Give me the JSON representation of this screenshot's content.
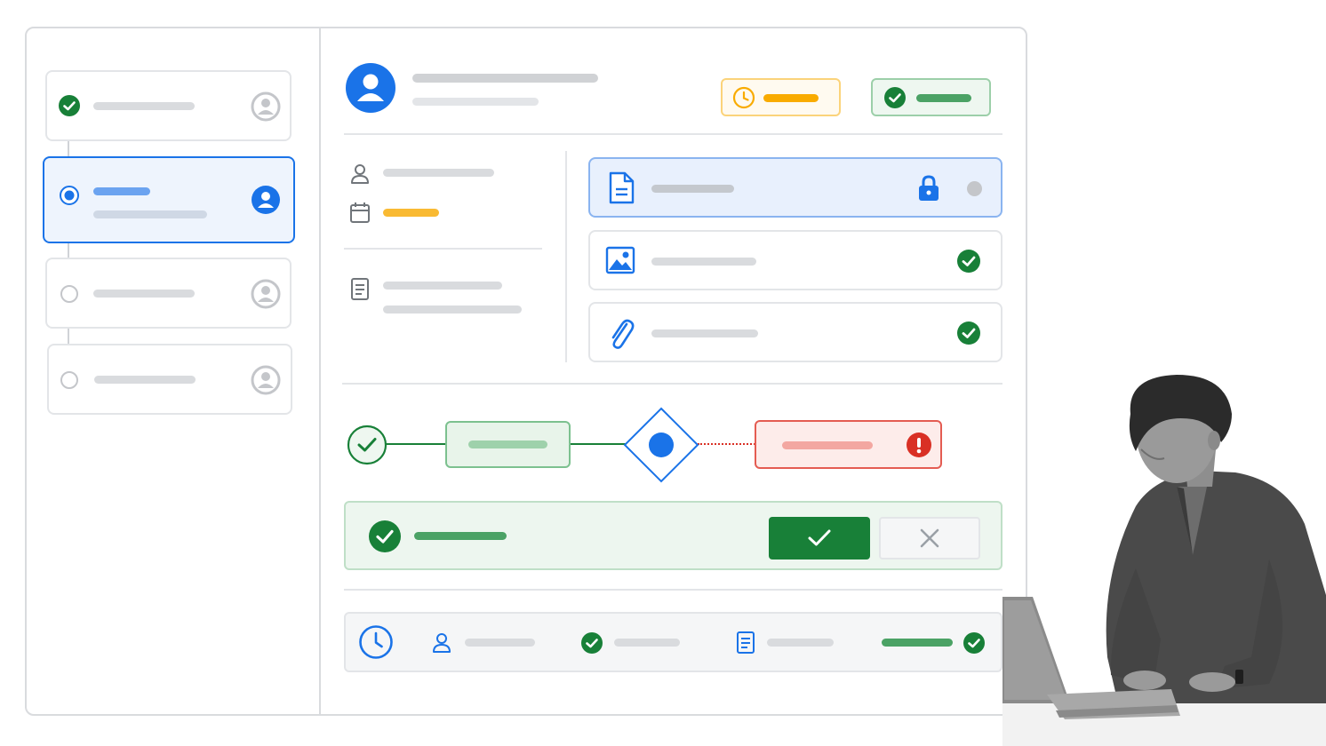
{
  "colors": {
    "primary": "#1a73e8",
    "success": "#188038",
    "warning": "#f9ab00",
    "error": "#d93025",
    "border": "#dadce0",
    "muted": "#bdc1c6"
  },
  "steps": [
    {
      "state": "complete",
      "status_icon": "check-circle-icon",
      "avatar_icon": "user-avatar-icon"
    },
    {
      "state": "active",
      "status_icon": "radio-active-icon",
      "avatar_icon": "user-avatar-icon"
    },
    {
      "state": "pending",
      "status_icon": "radio-empty-icon",
      "avatar_icon": "user-avatar-icon"
    },
    {
      "state": "pending",
      "status_icon": "radio-empty-icon",
      "avatar_icon": "user-avatar-icon"
    }
  ],
  "header": {
    "avatar_icon": "user-avatar-icon",
    "badges": [
      {
        "kind": "pending",
        "icon": "clock-icon",
        "color": "#f9ab00"
      },
      {
        "kind": "approved",
        "icon": "check-circle-icon",
        "color": "#188038"
      }
    ]
  },
  "details": {
    "rows": [
      {
        "icon": "person-icon"
      },
      {
        "icon": "calendar-icon",
        "highlight_color": "#f9ab00"
      },
      {
        "icon": "document-icon"
      }
    ]
  },
  "attachments": [
    {
      "icon": "document-icon",
      "status": "locked",
      "status_icon": "lock-icon",
      "selected": true
    },
    {
      "icon": "image-icon",
      "status": "verified",
      "status_icon": "check-circle-icon",
      "selected": false
    },
    {
      "icon": "paperclip-icon",
      "status": "verified",
      "status_icon": "check-circle-icon",
      "selected": false
    }
  ],
  "workflow": {
    "nodes": [
      {
        "type": "start",
        "icon": "check-icon",
        "state": "complete"
      },
      {
        "type": "task",
        "state": "complete"
      },
      {
        "type": "decision",
        "state": "active"
      },
      {
        "type": "task",
        "state": "error",
        "icon": "error-icon"
      }
    ]
  },
  "approval": {
    "status_icon": "check-circle-icon",
    "confirm_icon": "check-icon",
    "reject_icon": "close-icon"
  },
  "history": {
    "icons": [
      "clock-icon",
      "person-icon",
      "check-circle-icon",
      "document-icon",
      "check-circle-icon"
    ]
  }
}
